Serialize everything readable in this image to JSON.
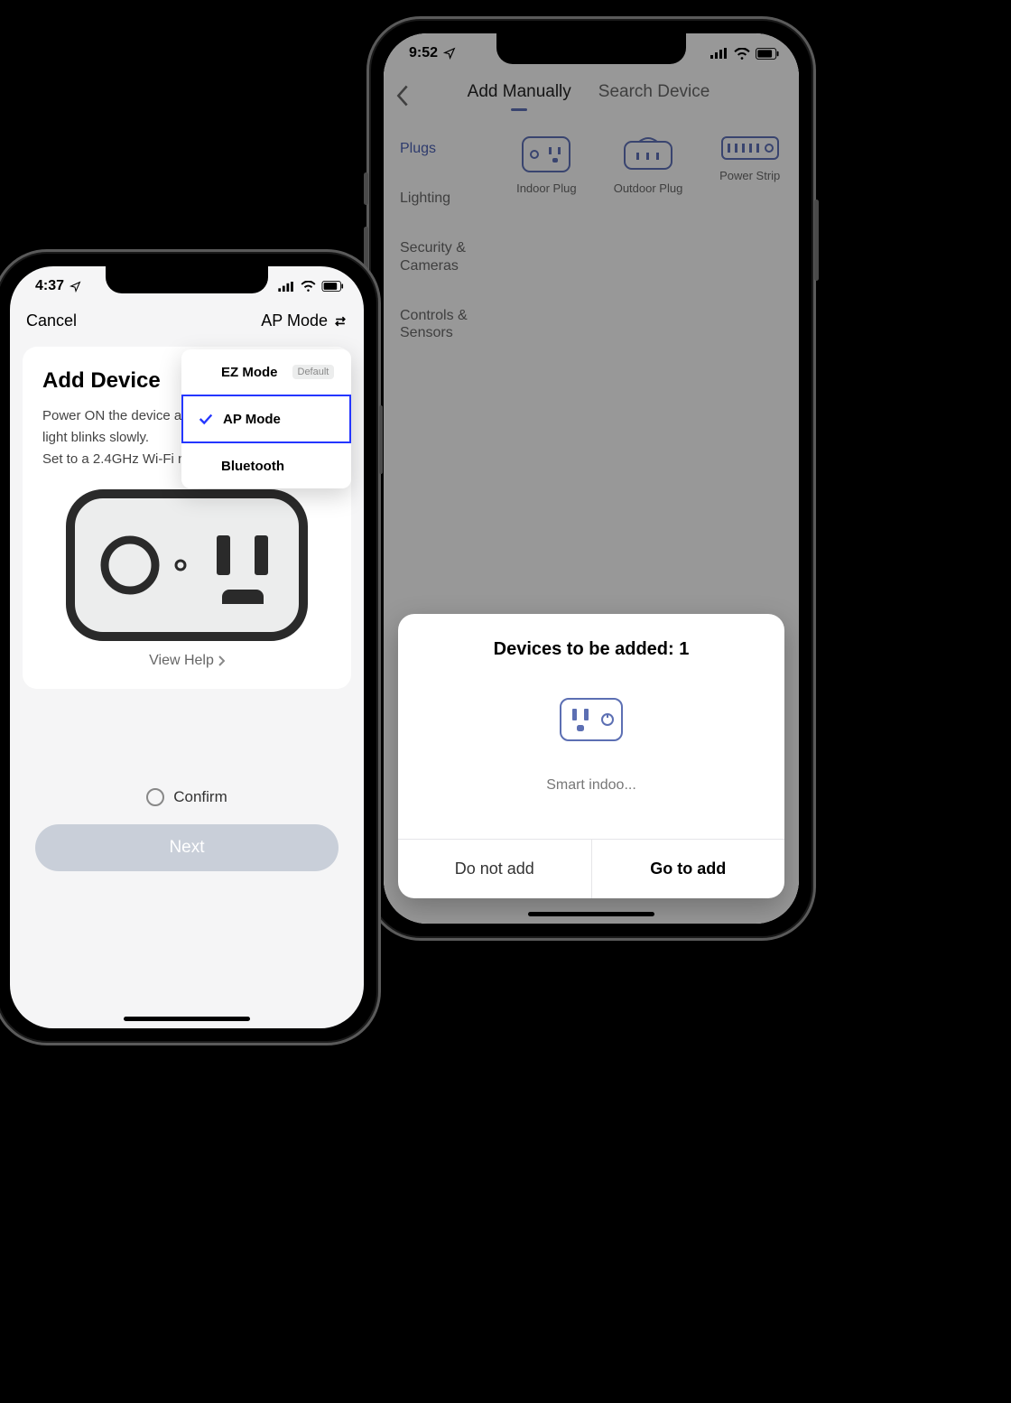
{
  "left": {
    "status_time": "4:37",
    "nav": {
      "cancel": "Cancel",
      "mode": "AP Mode"
    },
    "card": {
      "title": "Add Device",
      "line1": "Power ON the device an",
      "line2": "light blinks slowly.",
      "line3": "Set to a 2.4GHz Wi-Fi ne",
      "view_help": "View Help"
    },
    "confirm_label": "Confirm",
    "next_label": "Next",
    "dropdown": {
      "items": [
        {
          "label": "EZ Mode",
          "default_tag": "Default",
          "selected": false
        },
        {
          "label": "AP Mode",
          "default_tag": "",
          "selected": true
        },
        {
          "label": "Bluetooth",
          "default_tag": "",
          "selected": false
        }
      ]
    }
  },
  "right": {
    "status_time": "9:52",
    "nav": {
      "tab_manual": "Add Manually",
      "tab_search": "Search Device"
    },
    "sidebar": {
      "items": [
        "Plugs",
        "Lighting",
        "Security & Cameras",
        "Controls & Sensors"
      ]
    },
    "grid": {
      "items": [
        "Indoor Plug",
        "Outdoor Plug",
        "Power Strip"
      ]
    },
    "sheet": {
      "title": "Devices to be added: 1",
      "device_name": "Smart indoo...",
      "do_not_add": "Do not add",
      "go_to_add": "Go to add"
    }
  }
}
